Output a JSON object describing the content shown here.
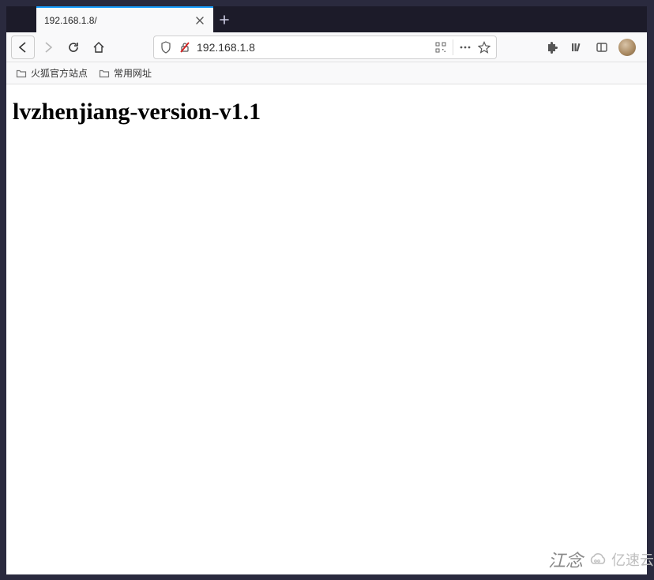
{
  "tab": {
    "title": "192.168.1.8/"
  },
  "urlbar": {
    "value": "192.168.1.8"
  },
  "bookmarks": {
    "item1": "火狐官方站点",
    "item2": "常用网址"
  },
  "page": {
    "heading": "lvzhenjiang-version-v1.1"
  },
  "watermark": {
    "text": "江念",
    "logo": "亿速云"
  }
}
